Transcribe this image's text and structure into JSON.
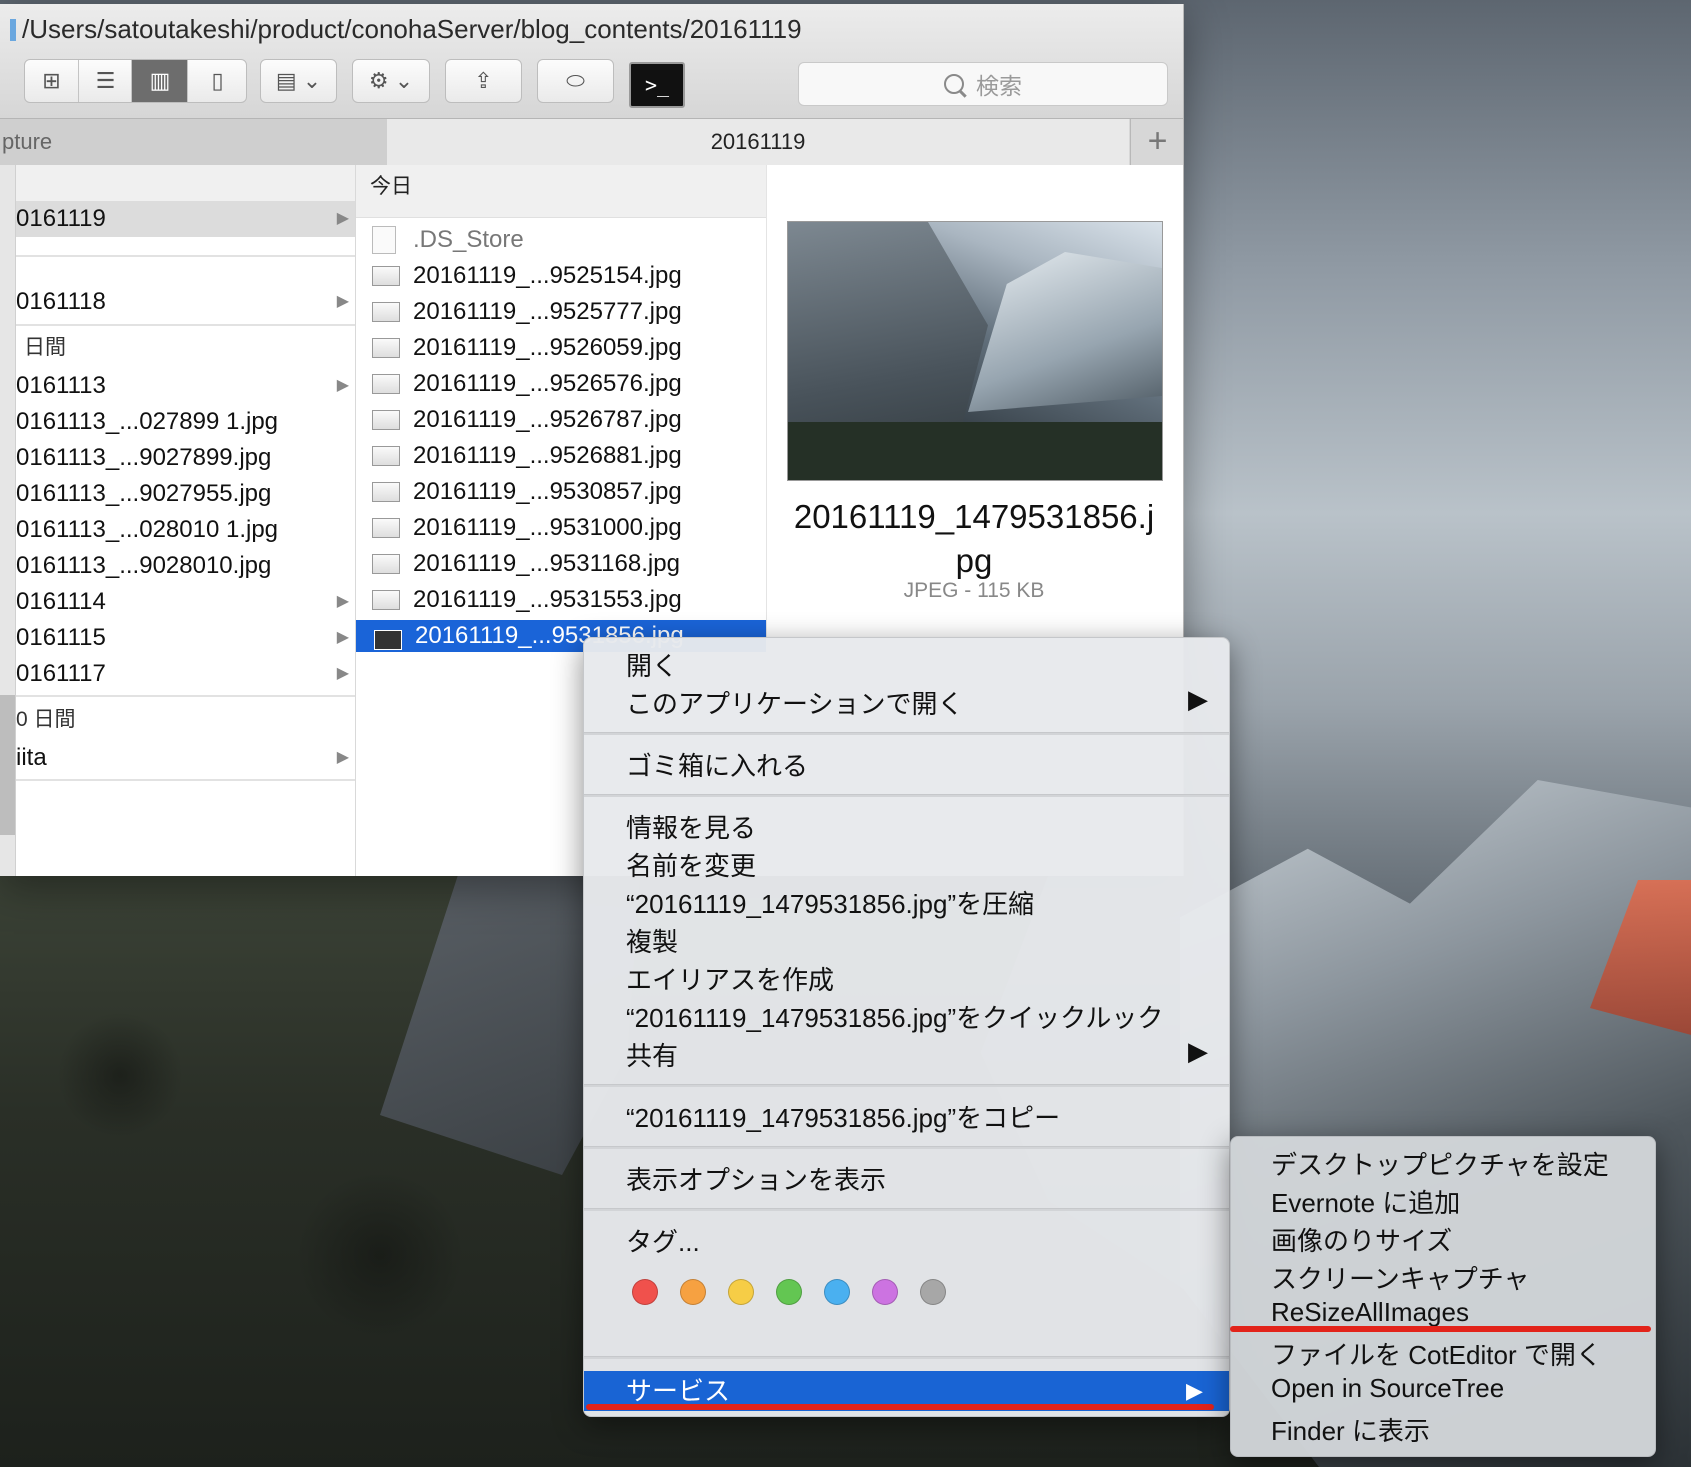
{
  "window": {
    "path_title": "/Users/satoutakeshi/product/conohaServer/blog_contents/20161119"
  },
  "toolbar": {
    "view_icon_glyph": "⊞",
    "view_list_glyph": "☰",
    "view_column_glyph": "▥",
    "view_cover_glyph": "▯",
    "arrange_glyph": "▤ ⌄",
    "action_glyph": "⚙ ⌄",
    "share_glyph": "⇪",
    "tag_glyph": "⬭",
    "terminal_glyph": ">_",
    "search_placeholder": "検索"
  },
  "tabs": {
    "left_label": "pture",
    "active_label": "20161119",
    "add_label": "+"
  },
  "column1": {
    "items": [
      {
        "label": "0161119",
        "arrow": "▶"
      },
      {
        "label": "0161118",
        "arrow": "▶"
      },
      {
        "label": "0161113",
        "arrow": "▶"
      },
      {
        "label": "0161113_...027899 1.jpg"
      },
      {
        "label": "0161113_...9027899.jpg"
      },
      {
        "label": "0161113_...9027955.jpg"
      },
      {
        "label": "0161113_...028010 1.jpg"
      },
      {
        "label": "0161113_...9028010.jpg"
      },
      {
        "label": "0161114",
        "arrow": "▶"
      },
      {
        "label": "0161115",
        "arrow": "▶"
      },
      {
        "label": "0161117",
        "arrow": "▶"
      },
      {
        "label": "iita",
        "arrow": "▶"
      }
    ],
    "group_week": "日間",
    "group_month": "0 日間"
  },
  "column2": {
    "header": "今日",
    "files": [
      ".DS_Store",
      "20161119_...9525154.jpg",
      "20161119_...9525777.jpg",
      "20161119_...9526059.jpg",
      "20161119_...9526576.jpg",
      "20161119_...9526787.jpg",
      "20161119_...9526881.jpg",
      "20161119_...9530857.jpg",
      "20161119_...9531000.jpg",
      "20161119_...9531168.jpg",
      "20161119_...9531553.jpg",
      "20161119_...9531856.jpg"
    ]
  },
  "preview": {
    "filename": "20161119_1479531856.jpg",
    "kind": "JPEG - 115 KB"
  },
  "context_menu": {
    "open": "開く",
    "open_with": "このアプリケーションで開く",
    "trash": "ゴミ箱に入れる",
    "get_info": "情報を見る",
    "rename": "名前を変更",
    "compress": "“20161119_1479531856.jpg”を圧縮",
    "duplicate": "複製",
    "make_alias": "エイリアスを作成",
    "quick_look": "“20161119_1479531856.jpg”をクイックルック",
    "share": "共有",
    "copy": "“20161119_1479531856.jpg”をコピー",
    "view_options": "表示オプションを表示",
    "tags": "タグ...",
    "services": "サービス",
    "submenu_arrow": "▶",
    "tag_colors": [
      "#f0514c",
      "#f6a141",
      "#f6cd46",
      "#63c652",
      "#4ab0f0",
      "#cc73e1",
      "#a7a7a7"
    ]
  },
  "services_submenu": {
    "items": [
      "デスクトップピクチャを設定",
      "Evernote に追加",
      "画像のりサイズ",
      "スクリーンキャプチャ",
      "ReSizeAllImages",
      "ファイルを CotEditor で開く",
      "Open in SourceTree",
      "Finder に表示"
    ]
  },
  "colors": {
    "selection_blue": "#1964d4",
    "annotation_red": "#e2231a"
  }
}
